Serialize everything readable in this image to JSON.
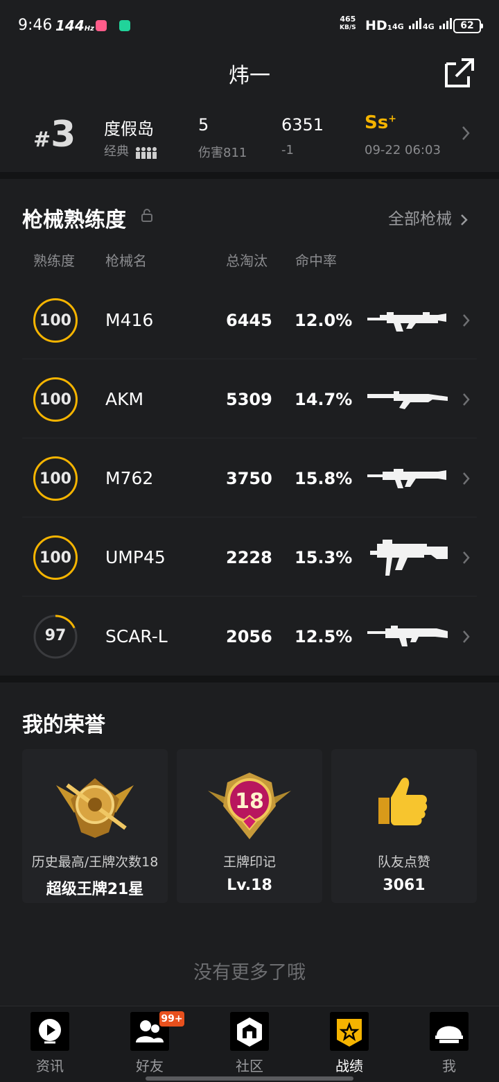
{
  "status_bar": {
    "time": "9:46",
    "refresh": "144",
    "refresh_unit": "Hz",
    "speed_value": "465",
    "speed_unit": "KB/S",
    "hd": "HD",
    "hd_sub": "1",
    "net1": "4G",
    "net2": "4G",
    "battery": "62"
  },
  "header": {
    "title": "炜一",
    "share_icon": "share-icon"
  },
  "match": {
    "rank_hash": "#",
    "rank": "3",
    "map": "度假岛",
    "mode": "经典",
    "kills": "5",
    "damage": "伤害811",
    "score": "6351",
    "score_change": "-1",
    "grade": "Ss",
    "grade_sup": "+",
    "time": "09-22 06:03"
  },
  "weapons": {
    "title": "枪械熟练度",
    "all_label": "全部枪械",
    "columns": [
      "熟练度",
      "枪械名",
      "总淘汰",
      "命中率"
    ],
    "rows": [
      {
        "level": "100",
        "level_fraction": 1.0,
        "name": "M416",
        "kills": "6445",
        "accuracy": "12.0%"
      },
      {
        "level": "100",
        "level_fraction": 1.0,
        "name": "AKM",
        "kills": "5309",
        "accuracy": "14.7%"
      },
      {
        "level": "100",
        "level_fraction": 1.0,
        "name": "M762",
        "kills": "3750",
        "accuracy": "15.8%"
      },
      {
        "level": "100",
        "level_fraction": 1.0,
        "name": "UMP45",
        "kills": "2228",
        "accuracy": "15.3%"
      },
      {
        "level": "97",
        "level_fraction": 0.18,
        "name": "SCAR-L",
        "kills": "2056",
        "accuracy": "12.5%"
      }
    ]
  },
  "honors": {
    "title": "我的荣誉",
    "cards": [
      {
        "label": "历史最高/王牌次数18",
        "value": "超级王牌21星",
        "icon": "ace-rank-badge-icon"
      },
      {
        "label": "王牌印记",
        "value": "Lv.18",
        "icon": "ace-mark-badge-icon",
        "badge_number": "18"
      },
      {
        "label": "队友点赞",
        "value": "3061",
        "icon": "thumbs-up-icon"
      }
    ]
  },
  "footer_text": "没有更多了哦",
  "tabs": [
    {
      "label": "资讯",
      "icon": "news-icon"
    },
    {
      "label": "好友",
      "icon": "friends-icon",
      "badge": "99+"
    },
    {
      "label": "社区",
      "icon": "community-icon"
    },
    {
      "label": "战绩",
      "icon": "record-icon",
      "active": true
    },
    {
      "label": "我",
      "icon": "profile-helmet-icon"
    }
  ],
  "colors": {
    "accent": "#f5b400",
    "background": "#1d1e20",
    "badge": "#e8501d"
  }
}
